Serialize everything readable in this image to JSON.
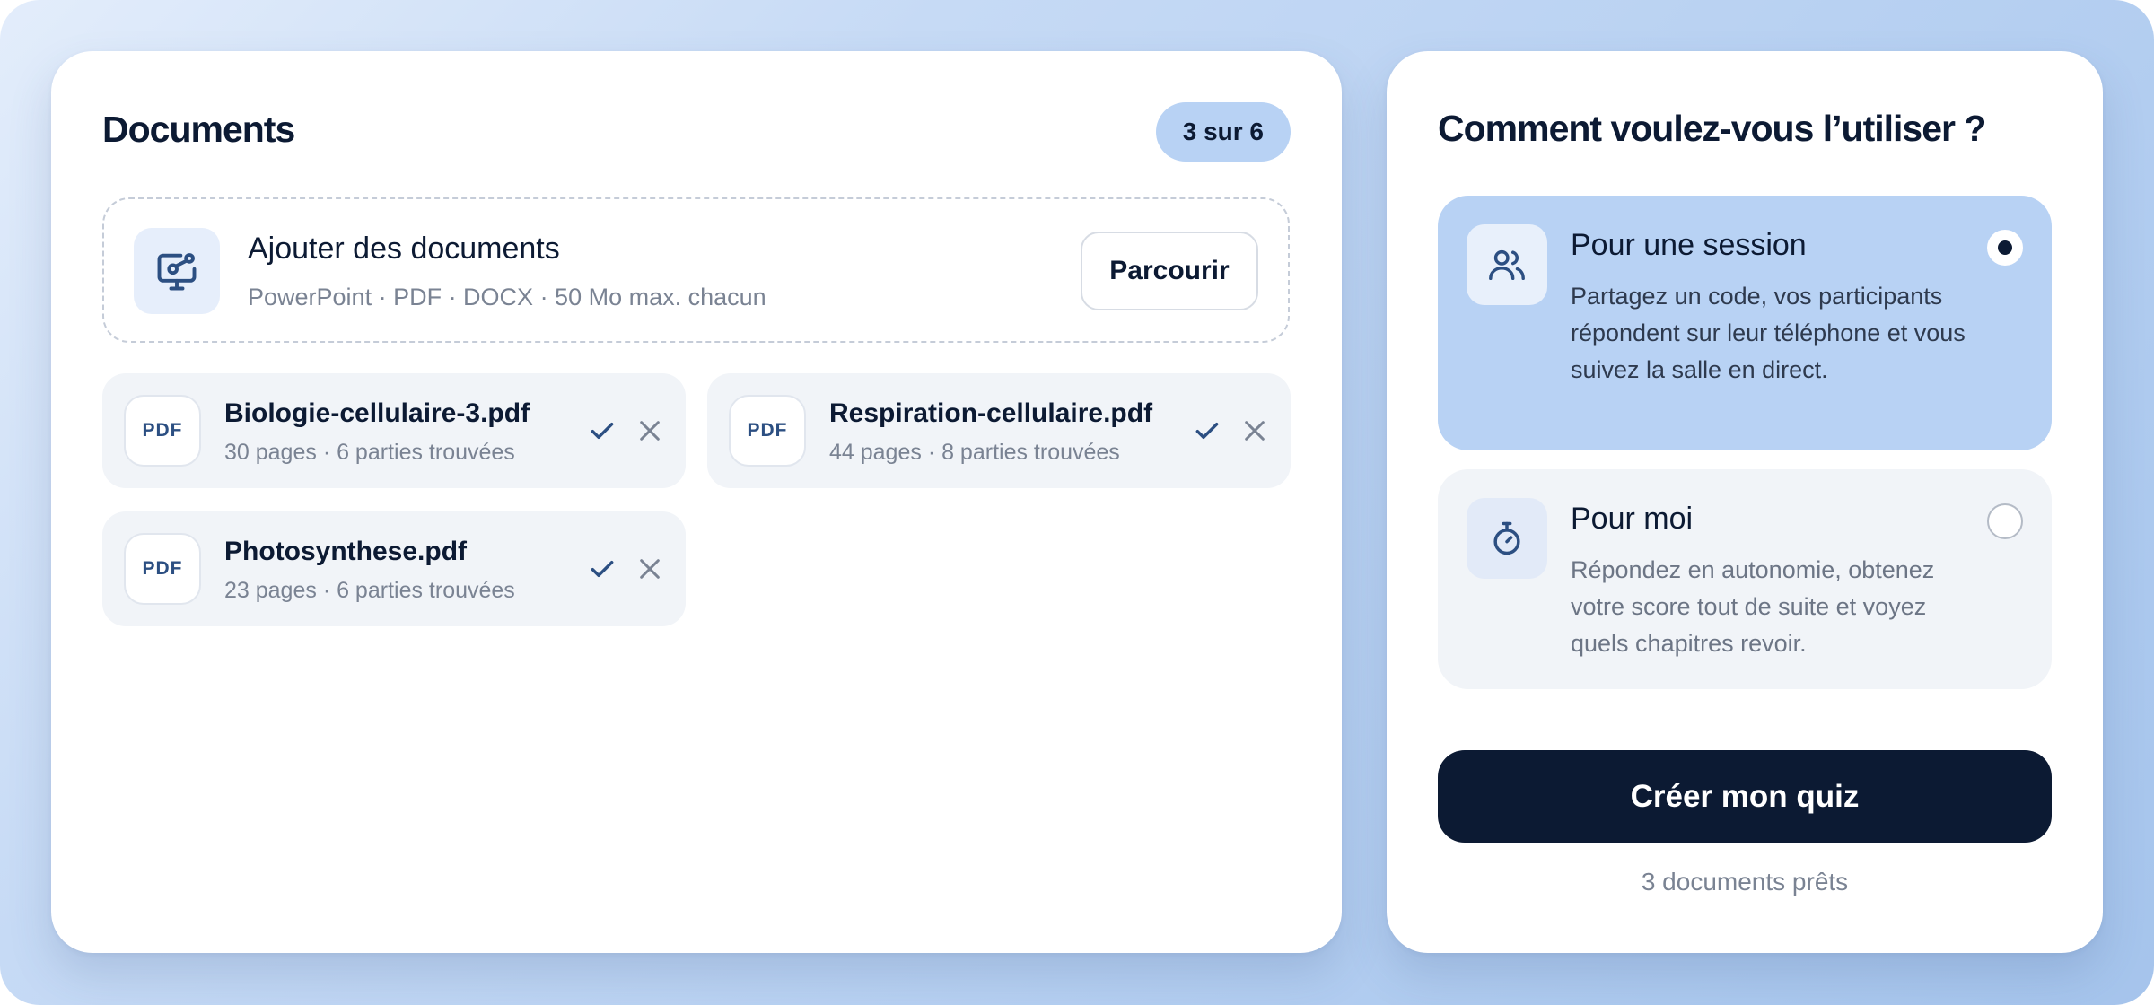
{
  "documents": {
    "title": "Documents",
    "count_badge": "3 sur 6",
    "dropzone": {
      "icon": "monitor-upload-icon",
      "title": "Ajouter des documents",
      "subtitle": "PowerPoint · PDF · DOCX · 50 Mo max. chacun",
      "browse_label": "Parcourir"
    },
    "files": [
      {
        "badge": "PDF",
        "name": "Biologie-cellulaire-3.pdf",
        "meta": "30 pages · 6 parties trouvées",
        "status": "check-icon"
      },
      {
        "badge": "PDF",
        "name": "Respiration-cellulaire.pdf",
        "meta": "44 pages · 8 parties trouvées",
        "status": "check-icon"
      },
      {
        "badge": "PDF",
        "name": "Photosynthese.pdf",
        "meta": "23 pages · 6 parties trouvées",
        "status": "check-icon"
      }
    ]
  },
  "usage": {
    "title": "Comment voulez-vous l’utiliser ?",
    "options": [
      {
        "icon": "users-icon",
        "title": "Pour une session",
        "description": "Partagez un code, vos participants répondent sur leur téléphone et vous suivez la salle en direct.",
        "selected": true
      },
      {
        "icon": "stopwatch-icon",
        "title": "Pour moi",
        "description": "Répondez en autonomie, obtenez votre score tout de suite et voyez quels chapitres revoir.",
        "selected": false
      }
    ],
    "create_label": "Créer mon quiz",
    "ready_text": "3 documents prêts"
  },
  "colors": {
    "ink": "#0c1a33",
    "accent_light": "#b8d2f4",
    "muted": "#7a8393",
    "surface": "#f1f4f8"
  }
}
